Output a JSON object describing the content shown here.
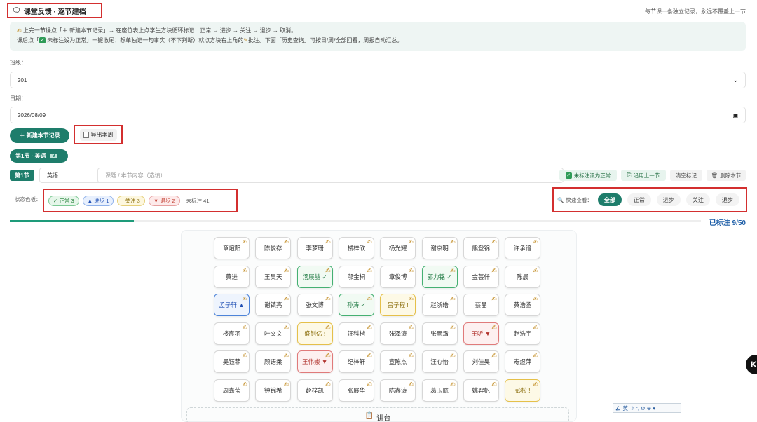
{
  "header": {
    "title": "课堂反馈 · 逐节建档",
    "title_icon": "chat-icon",
    "hint": "每节课一条独立记录，永远不覆盖上一节"
  },
  "info": {
    "line1": "上完一节课点「＋ 新建本节记录」→ 在座位表上点学生方块循环标记：正常 → 进步 → 关注 → 退步 → 取消。",
    "line2_a": "课后点「",
    "line2_b": " 未标注设为正常」一键收尾；想单独记一句事实（不下判断）就点方块右上角的",
    "line2_c": "批注。下面「历史查询」可按日/周/全部回看，周报自动汇总。"
  },
  "form": {
    "class_label": "班级：",
    "class_value": "201",
    "date_label": "日期：",
    "date_value": "2026/08/09"
  },
  "actions": {
    "new_record": "＋ 新建本节记录",
    "export_week": "导出本周"
  },
  "session_pill": {
    "label": "第1节 · 英语",
    "count": "9"
  },
  "session_row": {
    "session_num": "第1节",
    "subject": "英语",
    "topic_placeholder": "课题 / 本节内容（选填）",
    "mark_normal": "未标注设为正常",
    "copy_prev": "沿用上一节",
    "clear_marks": "清空标记",
    "delete": "删除本节"
  },
  "legend": {
    "label": "状态色板：",
    "normal": "✓ 正常 3",
    "progress": "▲ 进步 1",
    "concern": "! 关注 3",
    "regress": "▼ 退步 2",
    "unmarked": "未标注 41"
  },
  "filter": {
    "label": "快速查看：",
    "all": "全部",
    "normal": "正常",
    "progress": "进步",
    "concern": "关注",
    "regress": "退步"
  },
  "progress": {
    "text": "已标注 9/50",
    "fraction": 0.18
  },
  "seats": [
    [
      "章煊阳",
      "陈俊存",
      "李梦珊",
      "楼梓欣",
      "杨光耀",
      "谢京明",
      "熊登锦",
      "许承谙"
    ],
    [
      "黄进",
      "王昊天",
      "汤展喆 ✓",
      "邬金桐",
      "章俊博",
      "郭力铭 ✓",
      "金芸仟",
      "陈晨"
    ],
    [
      "孟子轩 ▲",
      "谢镇亮",
      "张文博",
      "孙涛 ✓",
      "吕子程 !",
      "赵浙皓",
      "蔡晶",
      "黄浩丞"
    ],
    [
      "楼宸羽",
      "叶文文",
      "盛钊亿 !",
      "汪科楷",
      "张泽涛",
      "张雨霜",
      "王听 ▼",
      "赵浩宇"
    ],
    [
      "吴钰菲",
      "顾语柔",
      "王伟崇 ▼",
      "纪梓轩",
      "宣陈杰",
      "汪心怡",
      "刘佳昊",
      "寿煜萍"
    ],
    [
      "周嘉莹",
      "钟锦希",
      "赵梓凯",
      "张展华",
      "陈鑫涛",
      "葛玉航",
      "姚羿帆",
      "彭松 !"
    ]
  ],
  "seat_status": [
    [
      "",
      "",
      "",
      "",
      "",
      "",
      "",
      ""
    ],
    [
      "",
      "",
      "normal",
      "",
      "",
      "normal",
      "",
      ""
    ],
    [
      "progress",
      "",
      "",
      "normal",
      "concern",
      "",
      "",
      ""
    ],
    [
      "",
      "",
      "concern",
      "",
      "",
      "",
      "regress",
      ""
    ],
    [
      "",
      "",
      "regress",
      "",
      "",
      "",
      "",
      ""
    ],
    [
      "",
      "",
      "",
      "",
      "",
      "",
      "",
      "concern"
    ]
  ],
  "podium": "讲台",
  "ime": "英 ☽ °, ⚙ ⊕ ▾"
}
